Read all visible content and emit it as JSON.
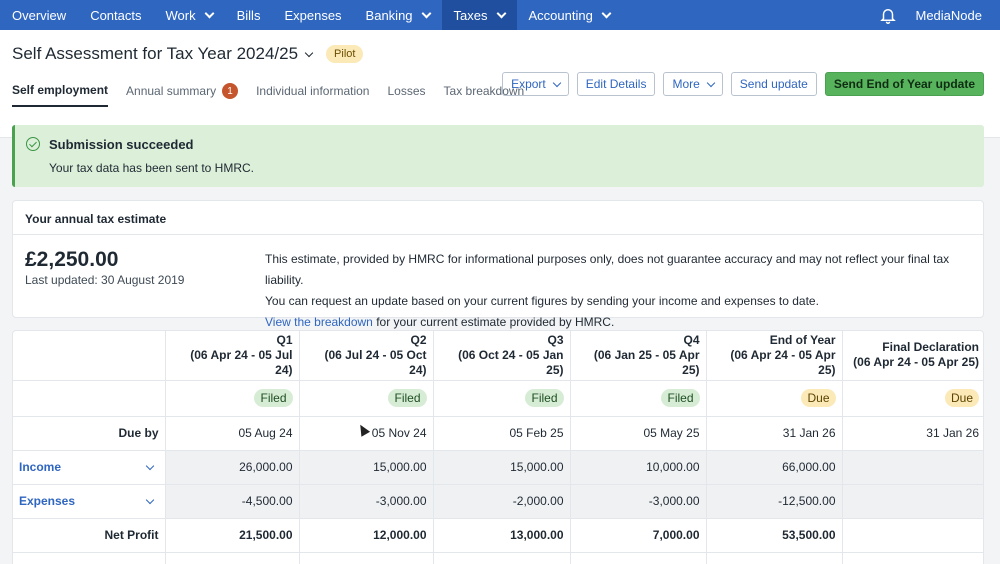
{
  "nav": {
    "items": [
      {
        "label": "Overview",
        "dropdown": false,
        "active": false
      },
      {
        "label": "Contacts",
        "dropdown": false,
        "active": false
      },
      {
        "label": "Work",
        "dropdown": true,
        "active": false
      },
      {
        "label": "Bills",
        "dropdown": false,
        "active": false
      },
      {
        "label": "Expenses",
        "dropdown": false,
        "active": false
      },
      {
        "label": "Banking",
        "dropdown": true,
        "active": false
      },
      {
        "label": "Taxes",
        "dropdown": true,
        "active": true
      },
      {
        "label": "Accounting",
        "dropdown": true,
        "active": false
      }
    ],
    "org_name": "MediaNode"
  },
  "header": {
    "title": "Self Assessment for Tax Year 2024/25",
    "badge": "Pilot",
    "buttons": {
      "export": "Export",
      "edit": "Edit Details",
      "more": "More",
      "send_update": "Send update",
      "send_eoy": "Send End of Year update"
    },
    "tabs": [
      {
        "label": "Self employment",
        "active": true
      },
      {
        "label": "Annual summary",
        "badge": "1"
      },
      {
        "label": "Individual information"
      },
      {
        "label": "Losses"
      },
      {
        "label": "Tax breakdown"
      }
    ]
  },
  "banner": {
    "title": "Submission succeeded",
    "text": "Your tax data has been sent to HMRC."
  },
  "estimate": {
    "heading": "Your annual tax estimate",
    "amount": "£2,250.00",
    "updated": "Last updated: 30 August 2019",
    "line1": "This estimate, provided by HMRC for informational purposes only, does not guarantee accuracy and may not reflect your final tax liability.",
    "line2": "You can request an update based on your current figures by sending your income and expenses to date.",
    "link": "View the breakdown",
    "line3_rest": " for your current estimate provided by HMRC."
  },
  "table": {
    "columns": [
      {
        "name": "Q1",
        "range": "(06 Apr 24 - 05 Jul 24)",
        "status": "Filed",
        "due": "05 Aug 24"
      },
      {
        "name": "Q2",
        "range": "(06 Jul 24 - 05 Oct 24)",
        "status": "Filed",
        "due": "05 Nov 24"
      },
      {
        "name": "Q3",
        "range": "(06 Oct 24 - 05 Jan 25)",
        "status": "Filed",
        "due": "05 Feb 25"
      },
      {
        "name": "Q4",
        "range": "(06 Jan 25 - 05 Apr 25)",
        "status": "Filed",
        "due": "05 May 25"
      },
      {
        "name": "End of Year",
        "range": "(06 Apr 24 - 05 Apr 25)",
        "status": "Due",
        "due": "31 Jan 26"
      },
      {
        "name": "Final Declaration",
        "range": "(06 Apr 24 - 05 Apr 25)",
        "status": "Due",
        "due": "31 Jan 26"
      }
    ],
    "due_by_label": "Due by",
    "rows": [
      {
        "label": "Income",
        "link": true,
        "values": [
          "26,000.00",
          "15,000.00",
          "15,000.00",
          "10,000.00",
          "66,000.00",
          ""
        ]
      },
      {
        "label": "Expenses",
        "link": true,
        "values": [
          "-4,500.00",
          "-3,000.00",
          "-2,000.00",
          "-3,000.00",
          "-12,500.00",
          ""
        ]
      },
      {
        "label": "Net Profit",
        "link": false,
        "values": [
          "21,500.00",
          "12,000.00",
          "13,000.00",
          "7,000.00",
          "53,500.00",
          ""
        ]
      }
    ]
  }
}
